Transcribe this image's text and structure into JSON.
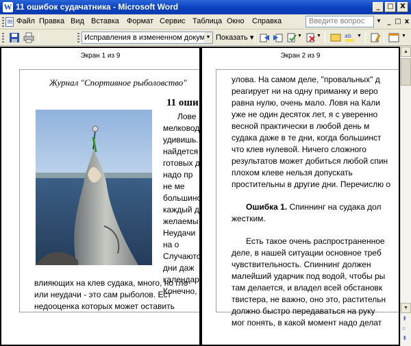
{
  "window": {
    "title": "11 ошибок судачатника - Microsoft Word",
    "title_icon": "W",
    "controls": {
      "minimize": "_",
      "maximize": "□",
      "close": "X"
    }
  },
  "menubar": {
    "items": [
      "Файл",
      "Правка",
      "Вид",
      "Вставка",
      "Формат",
      "Сервис",
      "Таблица",
      "Окно",
      "Справка"
    ],
    "help_placeholder": "Введите вопрос",
    "doc_controls": {
      "minimize": "_",
      "restore": "□",
      "close": "x"
    }
  },
  "toolbar": {
    "track_changes_combo": "Исправления в измененном документе",
    "show_button": "Показать ▾",
    "icons": [
      "save-icon",
      "print-icon",
      "accept-change-icon",
      "reject-change-icon",
      "comment-icon",
      "folder-icon",
      "spelling-icon",
      "highlight-icon",
      "reviewing-pane-icon"
    ]
  },
  "left_pane": {
    "screen_label": "Экран 1 из 9",
    "journal_title": "Журнал \"Спортивное рыболовство\"",
    "heading": "11 оши",
    "beside_photo_lines": [
      "Лове",
      "мелковод",
      "удивишь.",
      "найдется",
      "готовых д",
      "надо пр",
      "не ме",
      "большинс",
      "каждый д",
      "желаемы",
      "Неудачи",
      "на о",
      "Случаютс",
      "дни даж",
      "календар",
      "Конечно,"
    ],
    "bottom_lines": [
      "влияющих на клев судака, много, но гло",
      "или неудачи - это сам рыболов. Ест",
      "недооценка которых может оставить"
    ]
  },
  "right_pane": {
    "screen_label": "Экран 2 из 9",
    "paragraph1": [
      "улова. На самом деле, \"провальных\" д",
      "реагирует ни на одну приманку и веро",
      "равна нулю, очень мало. Ловя на Кали",
      "уже не один десяток лет, я с уверенно",
      "весной практически в любой день м",
      "судака даже в те дни, когда большинст",
      "что клев нулевой. Ничего сложного",
      "результатов может добиться любой спин",
      "плохом клеве нельзя допускать",
      "простительны в другие дни. Перечислю о"
    ],
    "error_label": "Ошибка 1.",
    "error_text_first": " Спиннинг на судака дол",
    "error_text_second": "жестким.",
    "paragraph2": [
      "Есть такое очень распространенное",
      "деле, в нашей ситуации основное треб",
      "чувствительность. Спиннинг должен",
      "малейший ударчик под водой, чтобы ры",
      "там делается, и владел всей обстановк",
      "твистера, не важно, оно это, растительн",
      "должно быстро передаваться на руку",
      "мог понять, в какой момент надо делат"
    ]
  },
  "scrollbar": {
    "up": "▲",
    "down": "▼",
    "prev_page": "⇞",
    "browse": "○",
    "next_page": "⇟"
  },
  "colors": {
    "titlebar": "#0a3fbe",
    "chrome": "#ece9d8",
    "docarea": "#808080"
  }
}
